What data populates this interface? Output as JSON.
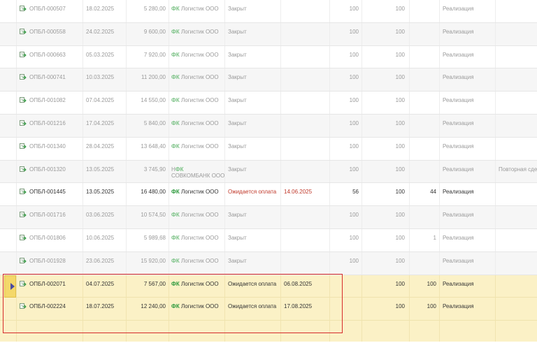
{
  "rows": [
    {
      "doc": "ОПБЛ-000507",
      "date": "18.02.2025",
      "sum": "5 280,00",
      "fk": "ФК",
      "org": "Логистик ООО",
      "status": "Закрыт",
      "due": "",
      "q1": "100",
      "q2": "100",
      "q3": "",
      "type": "Реализация",
      "note": ""
    },
    {
      "doc": "ОПБЛ-000558",
      "date": "24.02.2025",
      "sum": "9 600,00",
      "fk": "ФК",
      "org": "Логистик ООО",
      "status": "Закрыт",
      "due": "",
      "q1": "100",
      "q2": "100",
      "q3": "",
      "type": "Реализация",
      "note": ""
    },
    {
      "doc": "ОПБЛ-000663",
      "date": "05.03.2025",
      "sum": "7 920,00",
      "fk": "ФК",
      "org": "Логистик ООО",
      "status": "Закрыт",
      "due": "",
      "q1": "100",
      "q2": "100",
      "q3": "",
      "type": "Реализация",
      "note": ""
    },
    {
      "doc": "ОПБЛ-000741",
      "date": "10.03.2025",
      "sum": "11 200,00",
      "fk": "ФК",
      "org": "Логистик ООО",
      "status": "Закрыт",
      "due": "",
      "q1": "100",
      "q2": "100",
      "q3": "",
      "type": "Реализация",
      "note": ""
    },
    {
      "doc": "ОПБЛ-001082",
      "date": "07.04.2025",
      "sum": "14 550,00",
      "fk": "ФК",
      "org": "Логистик ООО",
      "status": "Закрыт",
      "due": "",
      "q1": "100",
      "q2": "100",
      "q3": "",
      "type": "Реализация",
      "note": ""
    },
    {
      "doc": "ОПБЛ-001216",
      "date": "17.04.2025",
      "sum": "5 840,00",
      "fk": "ФК",
      "org": "Логистик ООО",
      "status": "Закрыт",
      "due": "",
      "q1": "100",
      "q2": "100",
      "q3": "",
      "type": "Реализация",
      "note": ""
    },
    {
      "doc": "ОПБЛ-001340",
      "date": "28.04.2025",
      "sum": "13 648,40",
      "fk": "ФК",
      "org": "Логистик ООО",
      "status": "Закрыт",
      "due": "",
      "q1": "100",
      "q2": "100",
      "q3": "",
      "type": "Реализация",
      "note": ""
    },
    {
      "doc": "ОПБЛ-001320",
      "date": "13.05.2025",
      "sum": "3 745,90",
      "fk": "НФК",
      "org": "",
      "org2": "СОВКОМБАНК ООО",
      "status": "Закрыт",
      "due": "",
      "q1": "100",
      "q2": "100",
      "q3": "",
      "type": "Реализация",
      "note": "Повторная сде"
    },
    {
      "doc": "ОПБЛ-001445",
      "date": "13.05.2025",
      "sum": "16 480,00",
      "fk": "ФК",
      "org": "Логистик ООО",
      "status": "Ожидается оплата",
      "due": "14.06.2025",
      "q1": "56",
      "q2": "100",
      "q3": "44",
      "type": "Реализация",
      "note": ""
    },
    {
      "doc": "ОПБЛ-001716",
      "date": "03.06.2025",
      "sum": "10 574,50",
      "fk": "ФК",
      "org": "Логистик ООО",
      "status": "Закрыт",
      "due": "",
      "q1": "100",
      "q2": "100",
      "q3": "",
      "type": "Реализация",
      "note": ""
    },
    {
      "doc": "ОПБЛ-001806",
      "date": "10.06.2025",
      "sum": "5 989,68",
      "fk": "ФК",
      "org": "Логистик ООО",
      "status": "Закрыт",
      "due": "",
      "q1": "100",
      "q2": "100",
      "q3": "1",
      "type": "Реализация",
      "note": ""
    },
    {
      "doc": "ОПБЛ-001928",
      "date": "23.06.2025",
      "sum": "15 920,00",
      "fk": "ФК",
      "org": "Логистик ООО",
      "status": "Закрыт",
      "due": "",
      "q1": "100",
      "q2": "100",
      "q3": "",
      "type": "Реализация",
      "note": ""
    },
    {
      "doc": "ОПБЛ-002071",
      "date": "04.07.2025",
      "sum": "7 567,00",
      "fk": "ФК",
      "org": "Логистик ООО",
      "status": "Ожидается оплата",
      "due": "06.08.2025",
      "q1": "",
      "q2": "100",
      "q3": "100",
      "type": "Реализация",
      "note": ""
    },
    {
      "doc": "ОПБЛ-002224",
      "date": "18.07.2025",
      "sum": "12 240,00",
      "fk": "ФК",
      "org": "Логистик ООО",
      "status": "Ожидается оплата",
      "due": "17.08.2025",
      "q1": "",
      "q2": "100",
      "q3": "100",
      "type": "Реализация",
      "note": ""
    }
  ],
  "colors": {
    "selection": "#fbf1c6",
    "highlight_border": "#d62b2b",
    "fk_green": "#2e9a3e",
    "await_red": "#c0392b"
  },
  "icons": {
    "document": "document-arrow-icon",
    "current_row": "current-row-arrow-icon"
  }
}
